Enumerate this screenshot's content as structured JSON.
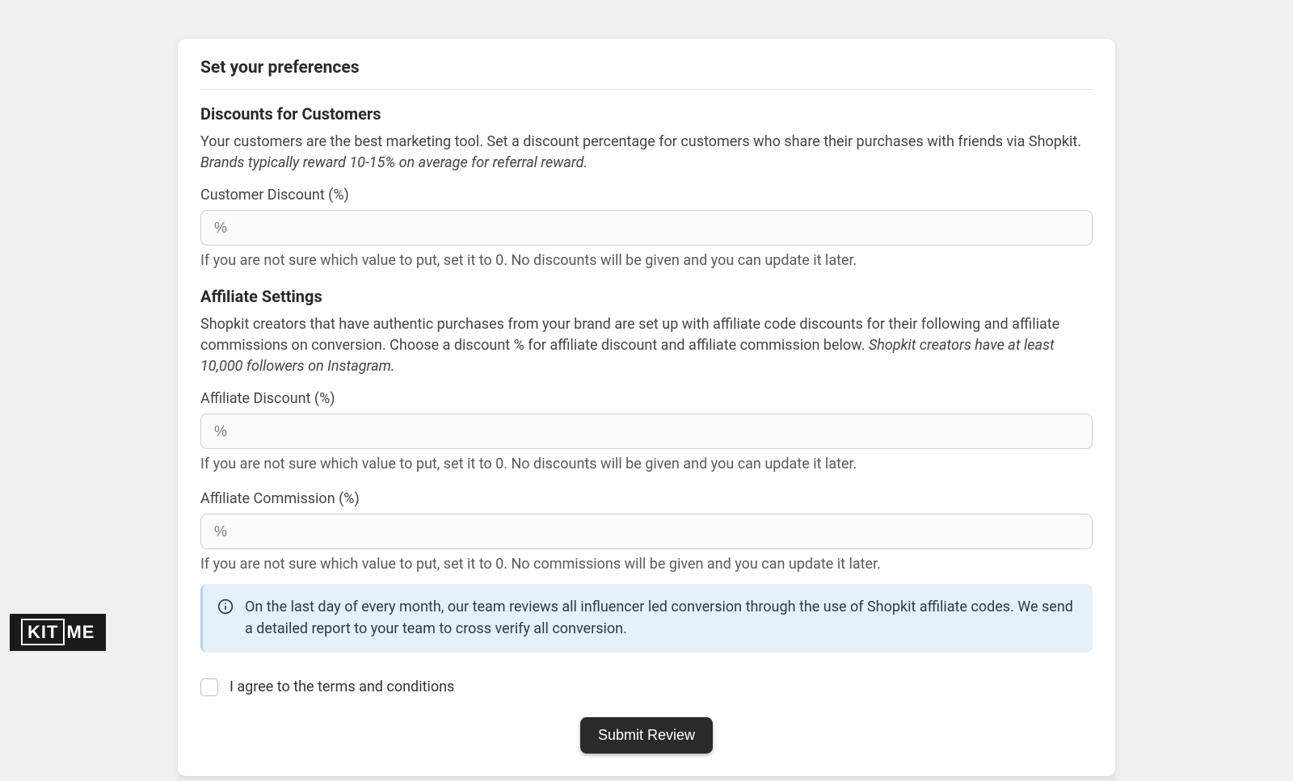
{
  "card": {
    "title": "Set your preferences"
  },
  "discounts": {
    "heading": "Discounts for Customers",
    "desc_main": "Your customers are the best marketing tool. Set a discount percentage for customers who share their purchases with friends via Shopkit. ",
    "desc_hint": "Brands typically reward 10-15% on average for referral reward.",
    "label": "Customer Discount (%)",
    "placeholder": "%",
    "help": "If you are not sure which value to put, set it to 0. No discounts will be given and you can update it later."
  },
  "affiliate": {
    "heading": "Affiliate Settings",
    "desc_main": "Shopkit creators that have authentic purchases from your brand are set up with affiliate code discounts for their following and affiliate commissions on conversion. Choose a discount % for affiliate discount and affiliate commission below. ",
    "desc_hint": "Shopkit creators have at least 10,000 followers on Instagram.",
    "discount_label": "Affiliate Discount (%)",
    "discount_placeholder": "%",
    "discount_help": "If you are not sure which value to put, set it to 0. No discounts will be given and you can update it later.",
    "commission_label": "Affiliate Commission (%)",
    "commission_placeholder": "%",
    "commission_help": "If you are not sure which value to put, set it to 0. No commissions will be given and you can update it later."
  },
  "info_banner": {
    "text": "On the last day of every month, our team reviews all influencer led conversion through the use of Shopkit affiliate codes. We send a detailed report to your team to cross verify all conversion."
  },
  "terms": {
    "label": "I agree to the terms and conditions"
  },
  "submit": {
    "label": "Submit Review"
  },
  "logo": {
    "part1": "KIT",
    "part2": "ME"
  }
}
